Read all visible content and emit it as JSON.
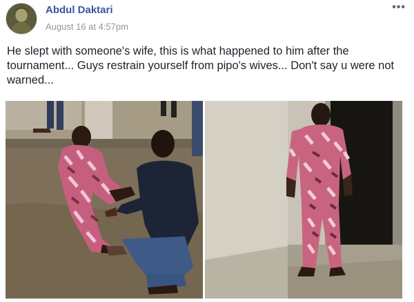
{
  "post": {
    "author": "Abdul Daktari",
    "timestamp": "August 16 at 4:57pm",
    "more_icon": "ellipsis-icon",
    "text": "He slept with someone's wife, this is what happened to him after the tournament... Guys restrain yourself from pipo's wives... Don't say u were not warned...",
    "photos": [
      {
        "name": "photo-man-sitting-on-ground"
      },
      {
        "name": "photo-man-standing-in-doorway"
      }
    ]
  }
}
